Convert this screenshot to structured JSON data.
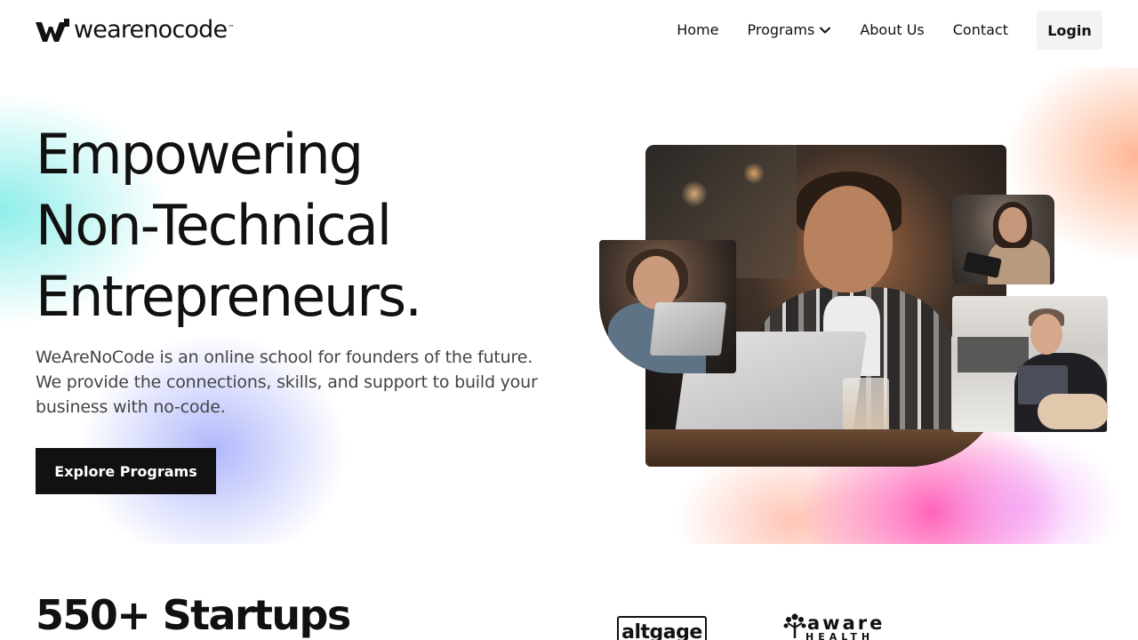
{
  "header": {
    "logo_text": "wearenocode",
    "logo_tm": "™",
    "nav": {
      "home": "Home",
      "programs": "Programs",
      "about": "About Us",
      "contact": "Contact",
      "login": "Login"
    }
  },
  "hero": {
    "headline_lines": [
      "Empowering",
      "Non-Technical",
      "Entrepreneurs."
    ],
    "subtext": "WeAreNoCode is an online school for founders of the future. We provide the connections, skills, and support to build your business with no-code.",
    "cta_label": "Explore Programs"
  },
  "startups": {
    "heading": "550+ Startups",
    "logos": [
      "altgage",
      "aware",
      "HEALTH"
    ]
  },
  "colors": {
    "text": "#111111",
    "subtext": "#444444",
    "cta_bg": "#111111",
    "login_bg": "#f3f3f3",
    "gradient_cyan": "#68e8e2",
    "gradient_blue": "#96a0fa",
    "gradient_pink": "#ff46aa",
    "gradient_peach": "#ffaa82"
  },
  "icons": {
    "logo": "wearenocode-logo-mark",
    "programs_dropdown": "chevron-down-icon"
  }
}
